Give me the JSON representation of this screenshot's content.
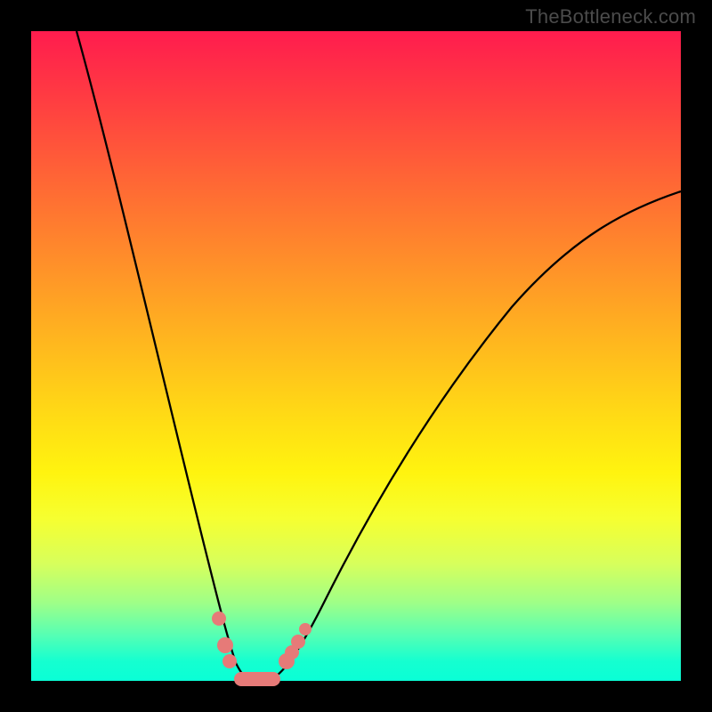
{
  "attribution": "TheBottleneck.com",
  "colors": {
    "gradient_top": "#ff1c4e",
    "gradient_bottom": "#0affd6",
    "curve": "#000000",
    "marker": "#e67a78",
    "frame": "#000000"
  },
  "chart_data": {
    "type": "line",
    "title": "",
    "xlabel": "",
    "ylabel": "",
    "xlim": [
      0,
      100
    ],
    "ylim": [
      0,
      100
    ],
    "series": [
      {
        "name": "left-branch",
        "x": [
          7,
          10,
          13,
          16,
          19,
          22,
          24,
          26,
          28,
          29,
          30,
          31,
          32
        ],
        "y": [
          100,
          87,
          74,
          61,
          48,
          35,
          24,
          15,
          8,
          4,
          1,
          0,
          0
        ]
      },
      {
        "name": "right-branch",
        "x": [
          36,
          38,
          40,
          43,
          47,
          52,
          58,
          66,
          76,
          88,
          100
        ],
        "y": [
          0,
          1,
          3,
          7,
          13,
          21,
          30,
          41,
          53,
          65,
          75
        ]
      }
    ],
    "markers": [
      {
        "x": 28,
        "y": 8
      },
      {
        "x": 29,
        "y": 4
      },
      {
        "x": 29.5,
        "y": 2
      },
      {
        "x": 38.5,
        "y": 2
      },
      {
        "x": 39,
        "y": 3
      },
      {
        "x": 40,
        "y": 4
      },
      {
        "x": 41,
        "y": 6
      }
    ],
    "flat_segment": {
      "x_start": 31,
      "x_end": 37,
      "y": 0
    }
  }
}
